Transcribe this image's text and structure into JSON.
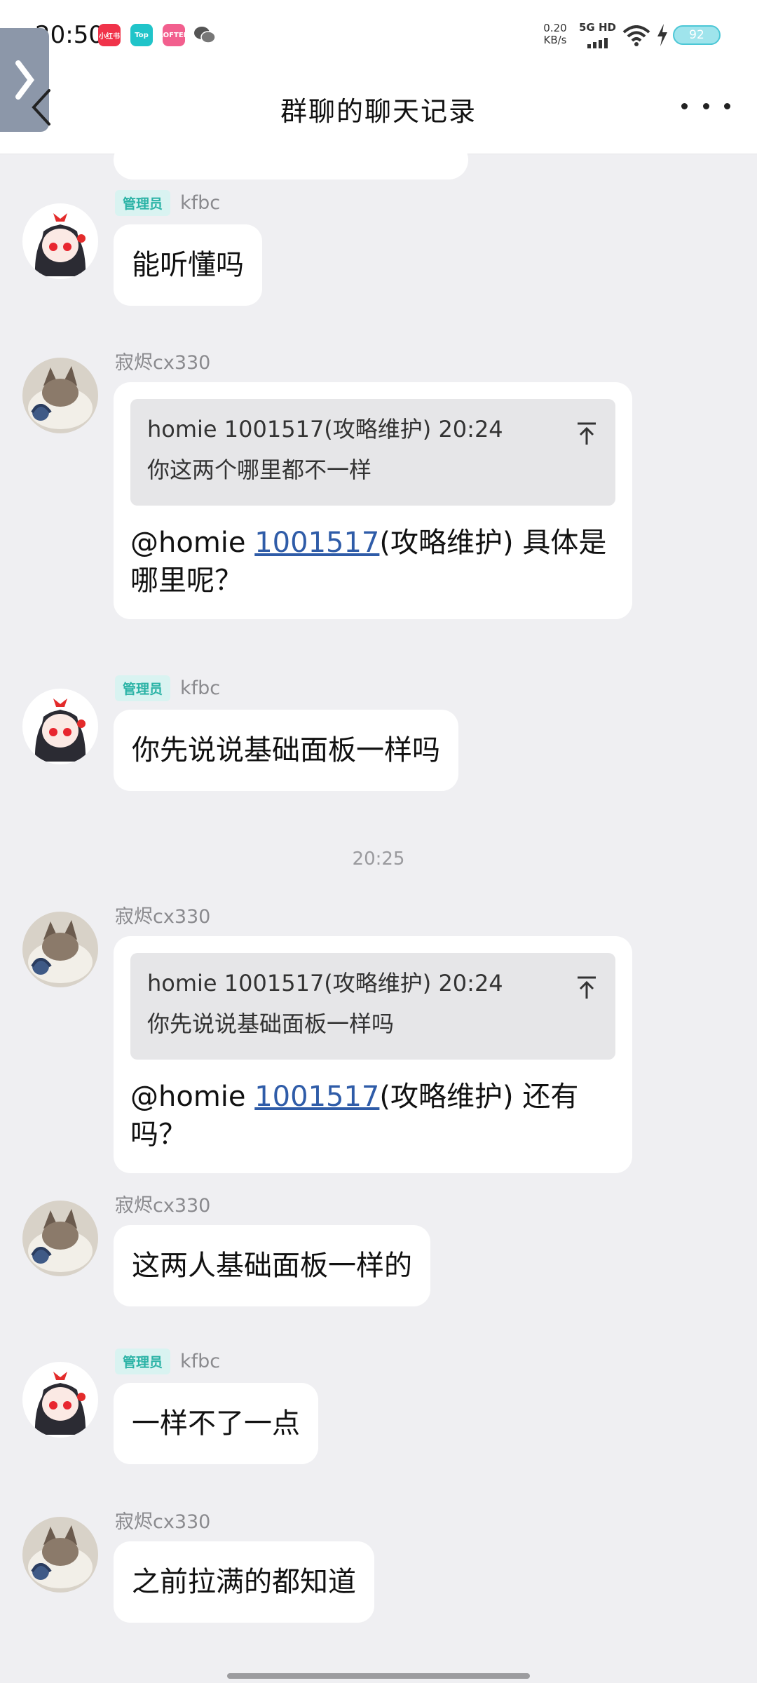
{
  "status_bar": {
    "time": "20:50",
    "notif_icons": [
      "小红书",
      "Top",
      "LOFTER",
      "wechat-icon"
    ],
    "net_speed_value": "0.20",
    "net_speed_unit": "KB/s",
    "net_type": "5G HD",
    "battery": "92"
  },
  "header": {
    "title": "群聊的聊天记录"
  },
  "messages": [
    {
      "role": "admin",
      "badge": "管理员",
      "sender": "kfbc",
      "text": "能听懂吗"
    },
    {
      "sender": "寂烬cx330",
      "quote": {
        "author": "homie 1001517(攻略维护) 20:24",
        "text": "你这两个哪里都不一样"
      },
      "reply_prefix": "@homie ",
      "reply_link": "1001517",
      "reply_suffix": "(攻略维护) 具体是哪里呢？"
    },
    {
      "role": "admin",
      "badge": "管理员",
      "sender": "kfbc",
      "text": "你先说说基础面板一样吗"
    },
    {
      "sender": "寂烬cx330",
      "quote": {
        "author": "homie 1001517(攻略维护) 20:24",
        "text": "你先说说基础面板一样吗"
      },
      "reply_prefix": "@homie ",
      "reply_link": "1001517",
      "reply_suffix": "(攻略维护) 还有吗？"
    },
    {
      "sender": "寂烬cx330",
      "text": "这两人基础面板一样的"
    },
    {
      "role": "admin",
      "badge": "管理员",
      "sender": "kfbc",
      "text": "一样不了一点"
    },
    {
      "sender": "寂烬cx330",
      "text": "之前拉满的都知道"
    }
  ],
  "time_divider": "20:25",
  "colors": {
    "background": "#efeff2",
    "bubble": "#ffffff",
    "admin_badge": "#2bb3a6",
    "link": "#2f5ca8"
  }
}
